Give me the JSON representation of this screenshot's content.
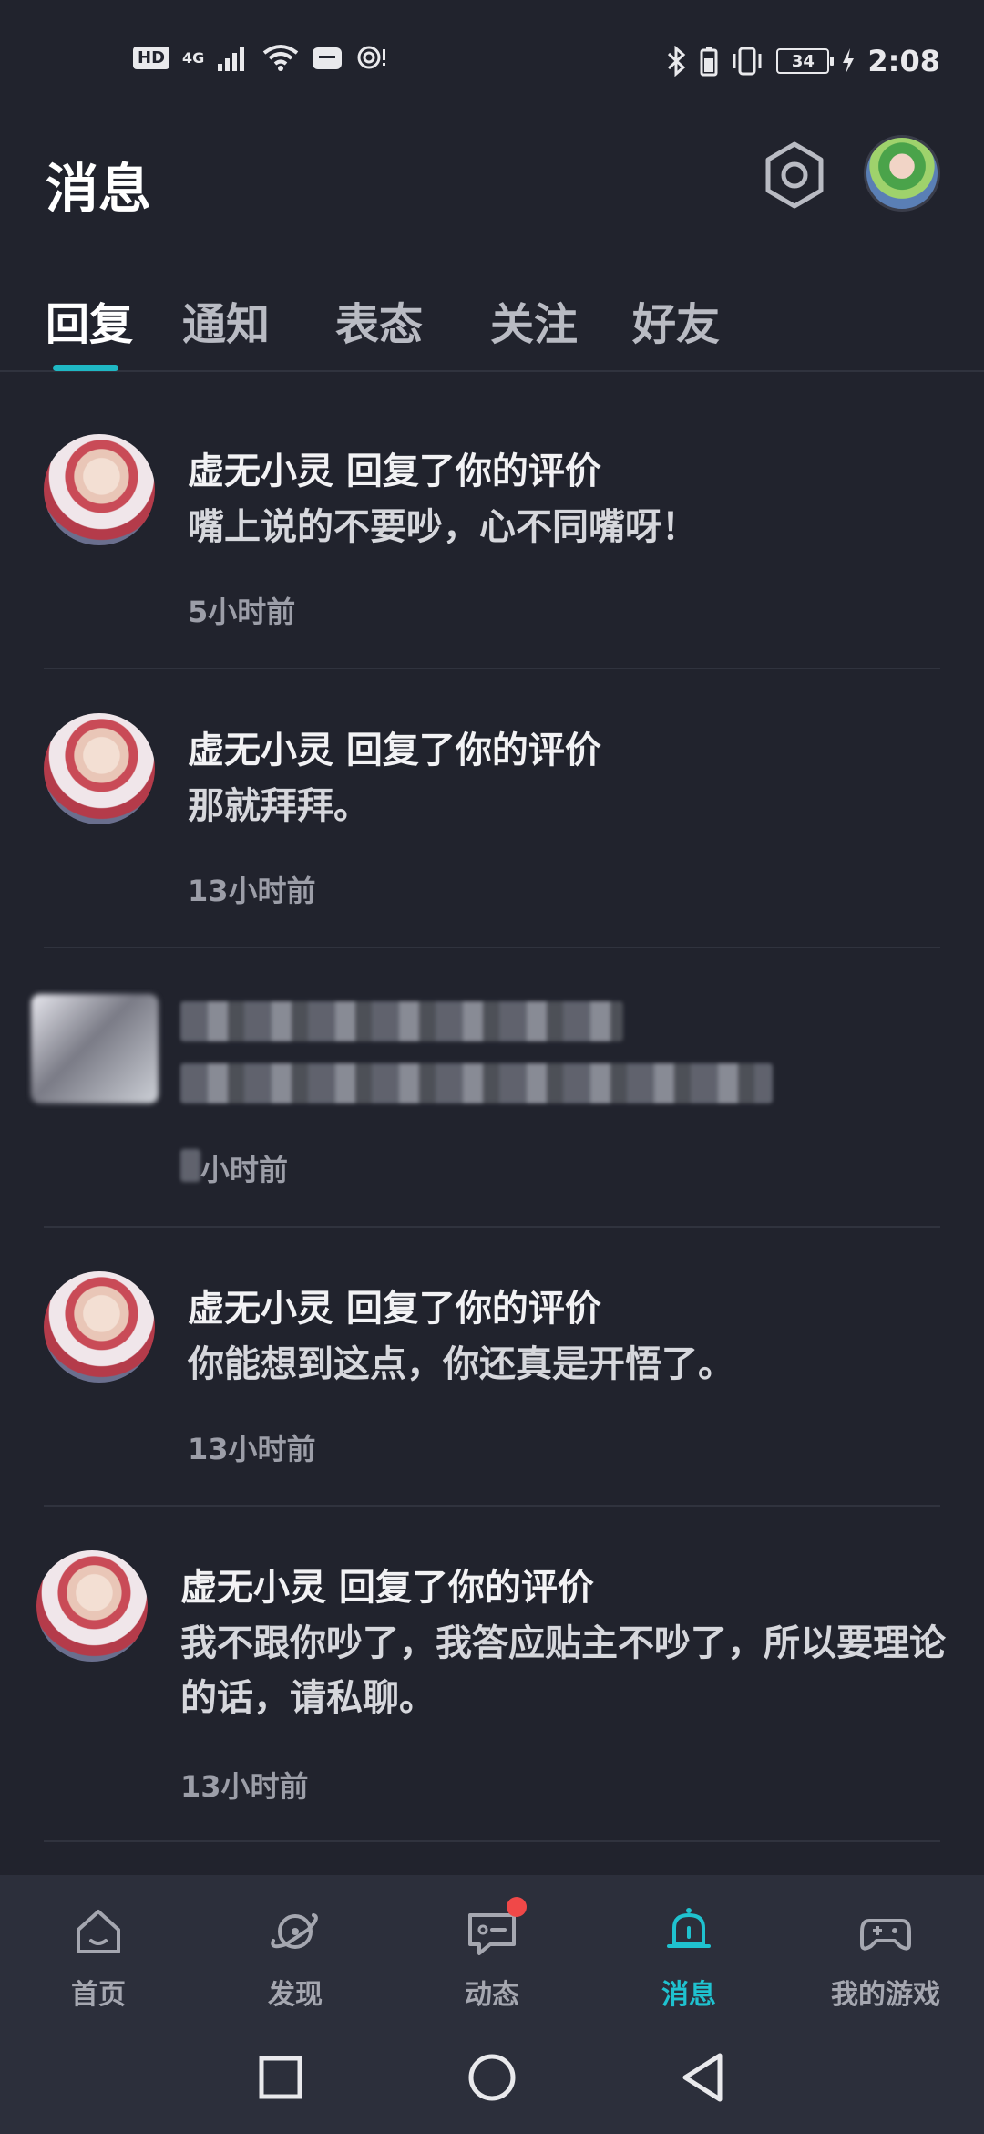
{
  "status_bar": {
    "hd": "HD",
    "network": "4G",
    "battery": "34",
    "time": "2:08"
  },
  "header": {
    "title": "消息"
  },
  "tabs": [
    {
      "label": "回复",
      "active": true
    },
    {
      "label": "通知",
      "active": false
    },
    {
      "label": "表态",
      "active": false
    },
    {
      "label": "关注",
      "active": false
    },
    {
      "label": "好友",
      "active": false
    }
  ],
  "messages": [
    {
      "title": "虚无小灵 回复了你的评价",
      "body": "嘴上说的不要吵，心不同嘴呀！",
      "time": "5小时前"
    },
    {
      "title": "虚无小灵 回复了你的评价",
      "body": "那就拜拜。",
      "time": "13小时前"
    },
    {
      "title": "",
      "body": "",
      "time": "小时前"
    },
    {
      "title": "虚无小灵 回复了你的评价",
      "body": "你能想到这点，你还真是开悟了。",
      "time": "13小时前"
    },
    {
      "title": "虚无小灵 回复了你的评价",
      "body": "我不跟你吵了，我答应贴主不吵了，所以要理论的话，请私聊。",
      "time": "13小时前"
    }
  ],
  "bottom_nav": [
    {
      "label": "首页",
      "icon": "home-icon",
      "active": false
    },
    {
      "label": "发现",
      "icon": "planet-icon",
      "active": false
    },
    {
      "label": "动态",
      "icon": "chat-icon",
      "active": false,
      "badge": true
    },
    {
      "label": "消息",
      "icon": "bell-icon",
      "active": true
    },
    {
      "label": "我的游戏",
      "icon": "gamepad-icon",
      "active": false
    }
  ],
  "colors": {
    "background": "#21232d",
    "accent": "#1fc2cf",
    "badge": "#f04848"
  }
}
